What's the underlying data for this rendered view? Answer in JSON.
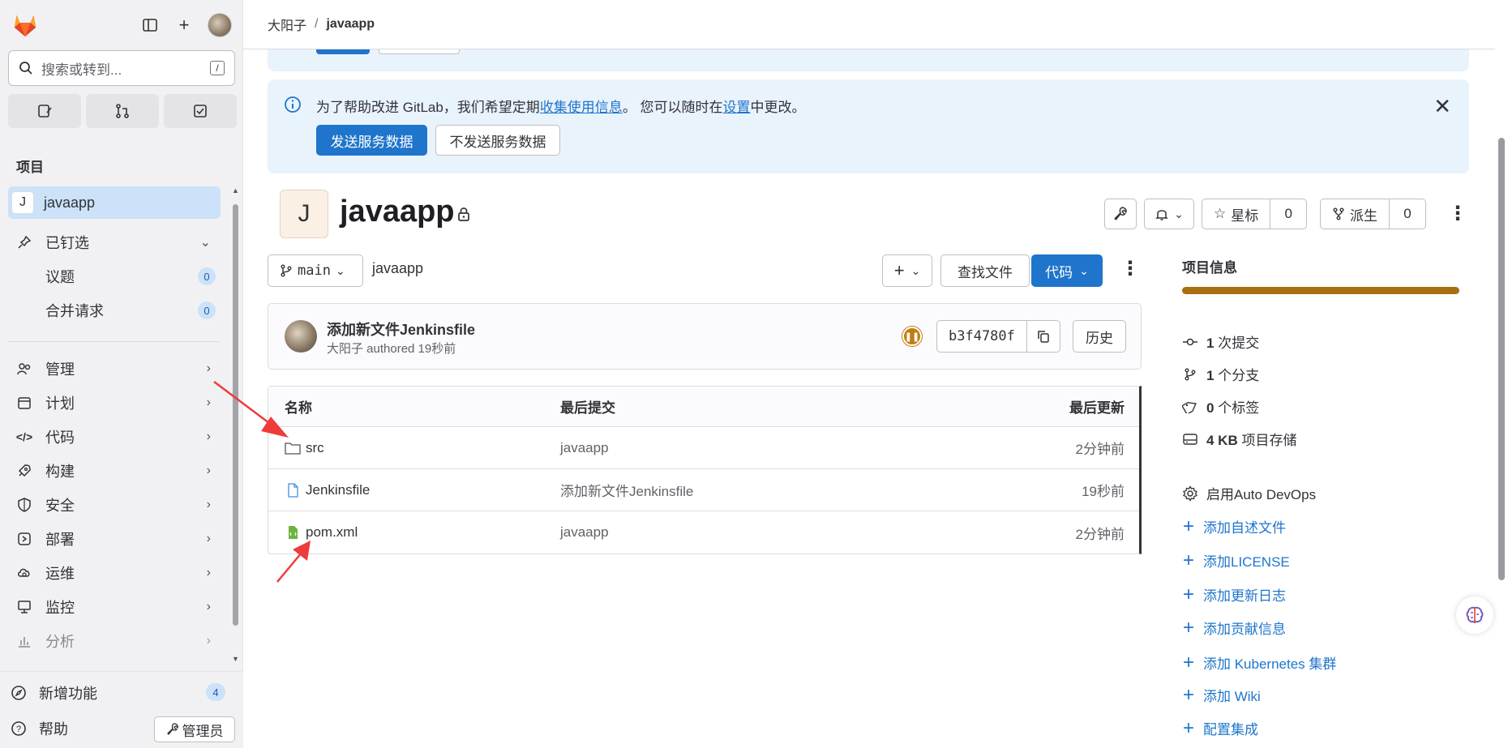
{
  "sidebar": {
    "search_placeholder": "搜索或转到...",
    "search_kbd": "/",
    "section_title": "项目",
    "current_project": {
      "initial": "J",
      "name": "javaapp"
    },
    "pinned": {
      "label": "已钉选",
      "items": [
        {
          "label": "议题",
          "count": "0"
        },
        {
          "label": "合并请求",
          "count": "0"
        }
      ]
    },
    "nav": [
      {
        "label": "管理",
        "icon": "users-icon"
      },
      {
        "label": "计划",
        "icon": "calendar-icon"
      },
      {
        "label": "代码",
        "icon": "code-icon"
      },
      {
        "label": "构建",
        "icon": "rocket-icon"
      },
      {
        "label": "安全",
        "icon": "shield-icon"
      },
      {
        "label": "部署",
        "icon": "deploy-icon"
      },
      {
        "label": "运维",
        "icon": "cloud-gear-icon"
      },
      {
        "label": "监控",
        "icon": "monitor-icon"
      },
      {
        "label": "分析",
        "icon": "chart-icon"
      }
    ],
    "whats_new": {
      "label": "新增功能",
      "count": "4"
    },
    "help": "帮助",
    "admin": "管理员"
  },
  "breadcrumb": {
    "parent": "大阳子",
    "separator": "/",
    "current": "javaapp"
  },
  "banner": {
    "text_before": "为了帮助改进 GitLab，我们希望定期",
    "link1": "收集使用信息",
    "text_mid": "。 您可以随时在",
    "link2": "设置",
    "text_after": "中更改。",
    "send_button": "发送服务数据",
    "no_send_button": "不发送服务数据"
  },
  "project": {
    "initial": "J",
    "name": "javaapp",
    "star_label": "星标",
    "star_count": "0",
    "fork_label": "派生",
    "fork_count": "0"
  },
  "repo": {
    "branch": "main",
    "path": "javaapp",
    "find_file": "查找文件",
    "code_button": "代码",
    "commit": {
      "title": "添加新文件Jenkinsfile",
      "meta": "大阳子 authored 19秒前",
      "sha": "b3f4780f",
      "history": "历史"
    },
    "table": {
      "headers": [
        "名称",
        "最后提交",
        "最后更新"
      ],
      "rows": [
        {
          "name": "src",
          "type": "folder",
          "commit": "javaapp",
          "updated": "2分钟前"
        },
        {
          "name": "Jenkinsfile",
          "type": "file",
          "commit": "添加新文件Jenkinsfile",
          "updated": "19秒前"
        },
        {
          "name": "pom.xml",
          "type": "xml",
          "commit": "javaapp",
          "updated": "2分钟前"
        }
      ]
    }
  },
  "project_info": {
    "title": "项目信息",
    "commits": {
      "num": "1",
      "label": "次提交"
    },
    "branches": {
      "num": "1",
      "label": "个分支"
    },
    "tags": {
      "num": "0",
      "label": "个标签"
    },
    "storage": {
      "num": "4 KB",
      "label": "项目存储"
    },
    "auto_devops": "启用Auto DevOps",
    "links": [
      "添加自述文件",
      "添加LICENSE",
      "添加更新日志",
      "添加贡献信息",
      "添加 Kubernetes 集群",
      "添加 Wiki",
      "配置集成"
    ]
  },
  "colors": {
    "primary": "#1f75cb",
    "sidebar_bg": "#f1f1f3",
    "banner_bg": "#e9f3fc",
    "active_item": "#cbe2f9",
    "pipeline": "#c17d10",
    "arrow": "#ee3b3b"
  }
}
